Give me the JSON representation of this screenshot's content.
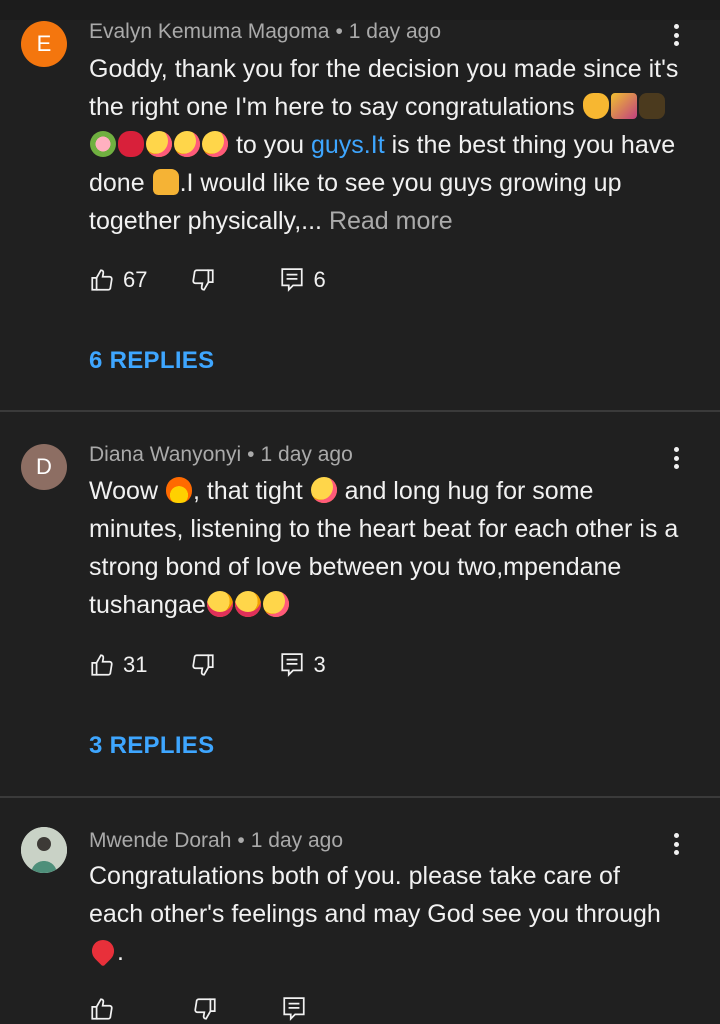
{
  "comments": [
    {
      "avatar_letter": "E",
      "avatar_color": "#f4760e",
      "author": "Evalyn Kemuma Magoma",
      "time": "1 day ago",
      "text_1": "Goddy, thank you for the decision you made since it's the right one I'm here to say congratulations",
      "text_2": " to you ",
      "link": "guys.It",
      "text_3": " is the best thing you have done ",
      "text_4": ".I would like to see you guys growing up together physically,... ",
      "read_more": "Read more",
      "likes": "67",
      "reply_count": "6",
      "replies_label": "6 REPLIES"
    },
    {
      "avatar_letter": "D",
      "avatar_color": "#8d6e63",
      "author": "Diana Wanyonyi",
      "time": "1 day ago",
      "text_1": "Woow ",
      "text_2": ", that tight ",
      "text_3": " and long hug for some minutes, listening to the heart beat for each other is a strong bond of love between you two,mpendane tushangae",
      "likes": "31",
      "reply_count": "3",
      "replies_label": "3 REPLIES"
    },
    {
      "author": "Mwende Dorah",
      "time": "1 day ago",
      "text_1": "Congratulations both of you. please take care of each other's feelings and may God see you through ",
      "text_2": "."
    }
  ],
  "separator": "•",
  "colors": {
    "background": "#202020",
    "link": "#3ea6ff",
    "meta": "#aaaaaa"
  }
}
